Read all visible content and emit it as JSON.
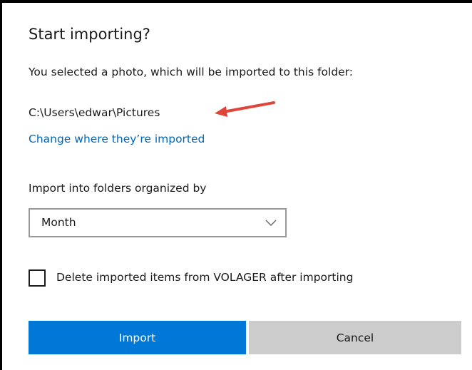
{
  "dialog": {
    "title": "Start importing?",
    "subtitle": "You selected a photo, which will be imported to this folder:",
    "folder_path": "C:\\Users\\edwar\\Pictures",
    "change_link": "Change where they’re imported",
    "organize_label": "Import into folders organized by",
    "organize_select": {
      "value": "Month",
      "icon": "chevron-down-icon"
    },
    "delete_checkbox": {
      "checked": false,
      "label": "Delete imported items from VOLAGER after importing"
    },
    "buttons": {
      "import": "Import",
      "cancel": "Cancel"
    }
  },
  "annotation": {
    "type": "arrow",
    "color": "#e0453a"
  },
  "colors": {
    "accent": "#0078d7",
    "link": "#0067b8",
    "secondary_button": "#cccccc",
    "annotation_arrow": "#e0453a"
  }
}
